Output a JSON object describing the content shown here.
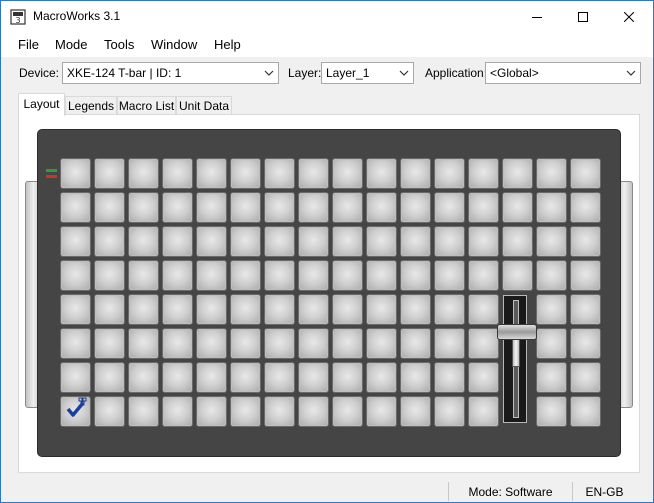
{
  "window": {
    "title": "MacroWorks 3.1"
  },
  "menu": {
    "items": [
      "File",
      "Mode",
      "Tools",
      "Window",
      "Help"
    ]
  },
  "toolbar": {
    "device_label": "Device:",
    "device_value": "XKE-124 T-bar | ID: 1",
    "layer_label": "Layer:",
    "layer_value": "Layer_1",
    "application_label": "Application:",
    "application_value": "<Global>"
  },
  "tabs": [
    {
      "label": "Layout",
      "active": true
    },
    {
      "label": "Legends",
      "active": false
    },
    {
      "label": "Macro List",
      "active": false
    },
    {
      "label": "Unit Data",
      "active": false
    }
  ],
  "device": {
    "columns": 16,
    "rows": 8,
    "tbar_columns": [
      13
    ],
    "tbar_rows": [
      4,
      5,
      6,
      7
    ],
    "led_colors": [
      "#2e9e3a",
      "#c8362b"
    ],
    "key_icon": "check-icon"
  },
  "status": {
    "mode": "Mode: Software",
    "locale": "EN-GB"
  },
  "colors": {
    "accent": "#2b78c5",
    "device_body": "#454545",
    "key": "#d0d0d0"
  }
}
